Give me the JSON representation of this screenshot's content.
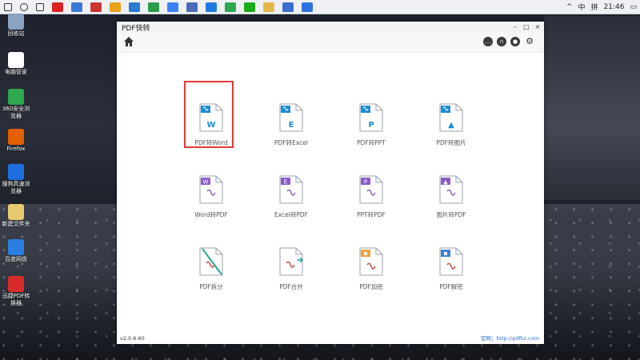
{
  "taskbar": {
    "time": "21:46",
    "ime": "中",
    "lang": "拼",
    "apps": [
      "start",
      "search",
      "task-view",
      "app-red1",
      "app-blue1",
      "app-red2",
      "app-chrome",
      "app-blue2",
      "app-green",
      "app-blue3",
      "app-monitor",
      "app-edge",
      "app-green2",
      "app-wechat",
      "app-folder",
      "app-blue4",
      "app-pdf-active"
    ]
  },
  "desktop": {
    "icons": [
      {
        "label": "回收站",
        "icon": "recycle-bin-icon",
        "color": "#8aa3c2"
      },
      {
        "label": "电脑管家",
        "icon": "pc-manager-icon",
        "color": "#ffffff"
      },
      {
        "label": "360安全浏览器",
        "icon": "browser-360-icon",
        "color": "#2fa84f"
      },
      {
        "label": "Firefox",
        "icon": "firefox-icon",
        "color": "#e66000"
      },
      {
        "label": "搜狗高速浏览器",
        "icon": "sogou-icon",
        "color": "#1d6fe0"
      },
      {
        "label": "新建文件夹",
        "icon": "folder-icon",
        "color": "#e6c86e"
      },
      {
        "label": "百度网盘",
        "icon": "cloud-icon",
        "color": "#2a7de1"
      },
      {
        "label": "迅捷PDF转换器",
        "icon": "pdf-icon",
        "color": "#d92b2b"
      }
    ]
  },
  "window": {
    "title": "PDF快转",
    "controls": {
      "minimize": "–",
      "maximize": "□",
      "close": "×"
    },
    "tools": {
      "chat": "…",
      "support": "∩",
      "user": "●",
      "settings": "⚙"
    },
    "tiles": [
      {
        "label": "PDF转Word",
        "badge": "W",
        "color": "#1e8ad6",
        "type": "pdf"
      },
      {
        "label": "PDF转Excel",
        "badge": "E",
        "color": "#1e8ad6",
        "type": "pdf"
      },
      {
        "label": "PDF转PPT",
        "badge": "P",
        "color": "#1e8ad6",
        "type": "pdf"
      },
      {
        "label": "PDF转图片",
        "badge": "▲",
        "color": "#1e8ad6",
        "type": "pdf"
      },
      {
        "label": "Word转PDF",
        "badge": "W",
        "color": "#8a5cc7",
        "type": "to-pdf"
      },
      {
        "label": "Excel转PDF",
        "badge": "E",
        "color": "#8a5cc7",
        "type": "to-pdf"
      },
      {
        "label": "PPT转PDF",
        "badge": "P",
        "color": "#8a5cc7",
        "type": "to-pdf"
      },
      {
        "label": "图片转PDF",
        "badge": "▲",
        "color": "#8a5cc7",
        "type": "to-pdf"
      },
      {
        "label": "PDF拆分",
        "badge": "",
        "color": "#29a7a0",
        "type": "split"
      },
      {
        "label": "PDF合并",
        "badge": "",
        "color": "#29a7a0",
        "type": "merge"
      },
      {
        "label": "PDF加密",
        "badge": "🔒",
        "color": "#f0a23a",
        "type": "lock"
      },
      {
        "label": "PDF解密",
        "badge": "🔓",
        "color": "#3b82d6",
        "type": "unlock"
      }
    ],
    "version": "v2.0.6.60",
    "website": "官网：http://pdfkz.com"
  }
}
